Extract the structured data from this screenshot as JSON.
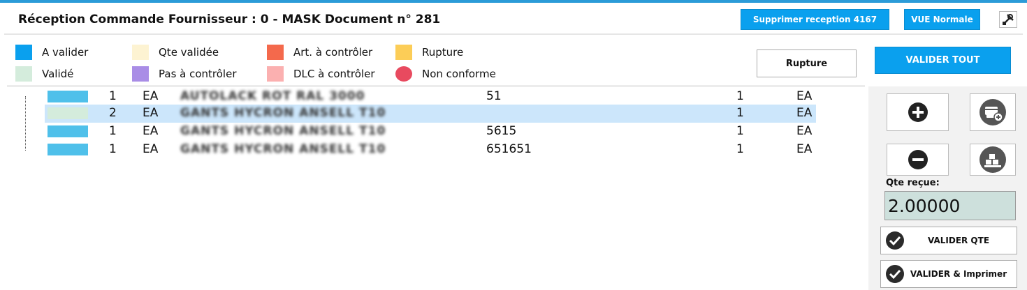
{
  "header": {
    "title": "Réception Commande Fournisseur : 0 - MASK Document n° 281",
    "delete_label": "Supprimer reception 4167",
    "view_label": "VUE Normale",
    "tools_icon": "tools-icon"
  },
  "legend": [
    {
      "label": "A valider",
      "color": "#0aa0ee"
    },
    {
      "label": "Validé",
      "color": "#d4ecdc"
    },
    {
      "label": "Qte validée",
      "color": "#fdf3d2"
    },
    {
      "label": "Pas à contrôler",
      "color": "#a98de6"
    },
    {
      "label": "Art. à contrôler",
      "color": "#f4694c"
    },
    {
      "label": "DLC à contrôler",
      "color": "#fbb0b0"
    },
    {
      "label": "Rupture",
      "color": "#fccd57"
    },
    {
      "label": "Non conforme",
      "color": "#e84a5f"
    }
  ],
  "toolbar": {
    "rupture_label": "Rupture",
    "validate_all_label": "VALIDER TOUT"
  },
  "rows": [
    {
      "qty": "1",
      "unit": "EA",
      "designation": "AUTOLACK ROT RAL 3000",
      "ref": "51",
      "qty_received": "1",
      "unit_received": "EA",
      "status_color": "#4fc0ea"
    },
    {
      "qty": "2",
      "unit": "EA",
      "designation": "GANTS HYCRON ANSELL T10",
      "ref": "",
      "qty_received": "1",
      "unit_received": "EA",
      "status_color": "#d4ecdc"
    },
    {
      "qty": "1",
      "unit": "EA",
      "designation": "GANTS HYCRON ANSELL T10",
      "ref": "5615",
      "qty_received": "1",
      "unit_received": "EA",
      "status_color": "#4fc0ea"
    },
    {
      "qty": "1",
      "unit": "EA",
      "designation": "GANTS HYCRON ANSELL T10",
      "ref": "651651",
      "qty_received": "1",
      "unit_received": "EA",
      "status_color": "#4fc0ea"
    }
  ],
  "side": {
    "qte_label": "Qte reçue:",
    "qte_value": "2.00000",
    "validate_qty_label": "VALIDER QTE",
    "validate_print_label": "VALIDER & Imprimer"
  },
  "colors": {
    "accent": "#0aa0ee",
    "selected_row": "#cce6fb",
    "qte_bg": "#cde0dc"
  }
}
